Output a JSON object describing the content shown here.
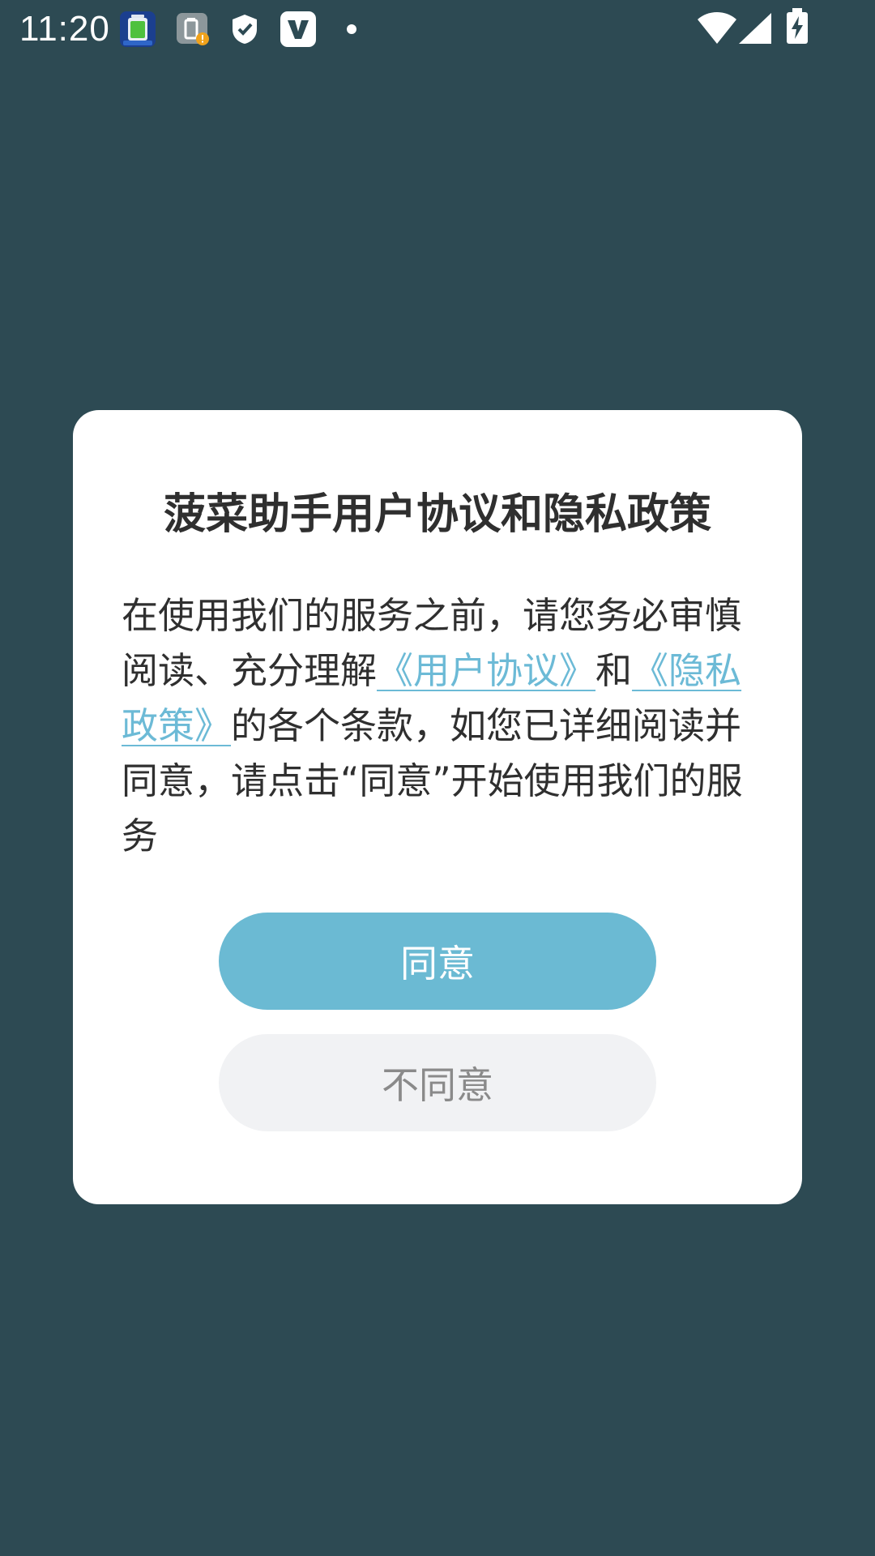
{
  "status_bar": {
    "time": "11:20",
    "notification_icons": [
      "battery-app-icon",
      "battery-alert-icon",
      "shield-icon",
      "v-app-icon",
      "dot-icon"
    ],
    "system_icons": [
      "wifi-icon",
      "signal-icon",
      "battery-charging-icon"
    ]
  },
  "dialog": {
    "title": "菠菜助手用户协议和隐私政策",
    "body_part1": "在使用我们的服务之前，请您务必审慎阅读、充分理解",
    "link_user_agreement": "《用户协议》",
    "body_part2": "和",
    "link_privacy_policy": "《隐私政策》",
    "body_part3": "的各个条款，如您已详细阅读并同意，请点击“同意”开始使用我们的服务",
    "agree_label": "同意",
    "disagree_label": "不同意"
  },
  "colors": {
    "background": "#2d4a53",
    "accent": "#6bbad3",
    "secondary_button": "#f1f2f4"
  }
}
